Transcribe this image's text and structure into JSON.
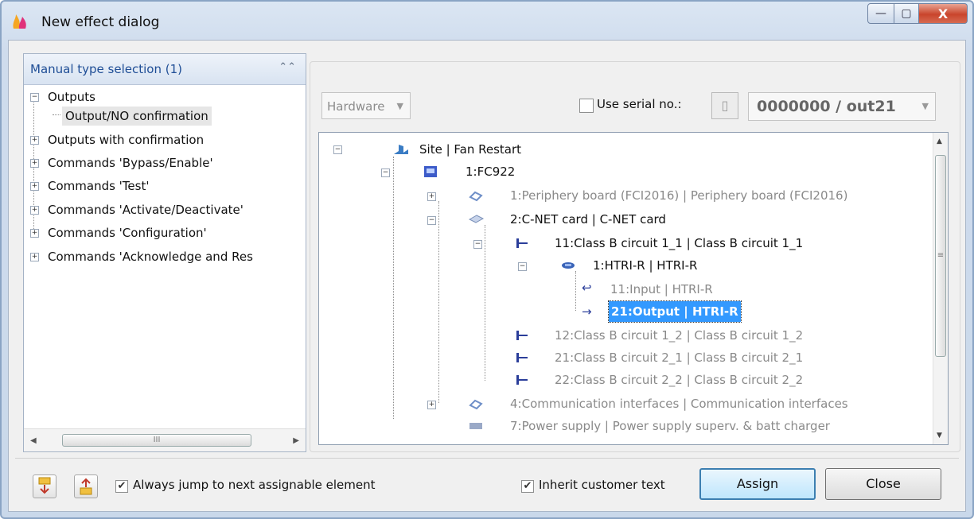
{
  "window": {
    "title": "New effect dialog",
    "buttons": {
      "minimize": "—",
      "maximize": "▢",
      "close": "X"
    }
  },
  "left_panel": {
    "header": "Manual type selection (1)",
    "items": [
      {
        "label": "Outputs",
        "expanded": true
      },
      {
        "label": "Output/NO confirmation",
        "selected": true
      },
      {
        "label": "Outputs with confirmation"
      },
      {
        "label": "Commands 'Bypass/Enable'"
      },
      {
        "label": "Commands 'Test'"
      },
      {
        "label": "Commands 'Activate/Deactivate'"
      },
      {
        "label": "Commands 'Configuration'"
      },
      {
        "label": "Commands 'Acknowledge and Res"
      }
    ],
    "scroll_thumb": "III"
  },
  "right_panel": {
    "hardware_combo": "Hardware",
    "use_serial_label": "Use serial no.:",
    "serial_value": "0000000 / out21",
    "tree": [
      {
        "text": "Site | Fan Restart"
      },
      {
        "text": "1:FC922"
      },
      {
        "text": "1:Periphery board (FCI2016) | Periphery board (FCI2016)"
      },
      {
        "text": "2:C-NET card | C-NET card"
      },
      {
        "text": "11:Class B circuit 1_1 | Class B circuit 1_1"
      },
      {
        "text": "1:HTRI-R | HTRI-R"
      },
      {
        "text": "11:Input | HTRI-R"
      },
      {
        "text": "21:Output | HTRI-R",
        "selected": true
      },
      {
        "text": "12:Class B circuit 1_2 | Class B circuit 1_2"
      },
      {
        "text": "21:Class B circuit 2_1 | Class B circuit 2_1"
      },
      {
        "text": "22:Class B circuit 2_2 | Class B circuit 2_2"
      },
      {
        "text": "4:Communication interfaces | Communication interfaces"
      },
      {
        "text": "7:Power supply | Power supply superv. & batt charger"
      }
    ],
    "scroll_thumb": "≡"
  },
  "bottom": {
    "always_jump_label": "Always jump to next assignable element",
    "always_jump_checked": true,
    "inherit_label": "Inherit customer text",
    "inherit_checked": true,
    "assign_label": "Assign",
    "close_label": "Close"
  },
  "colors": {
    "accent": "#3399ff",
    "header_text": "#1f4e96",
    "close_red": "#c9452c"
  }
}
